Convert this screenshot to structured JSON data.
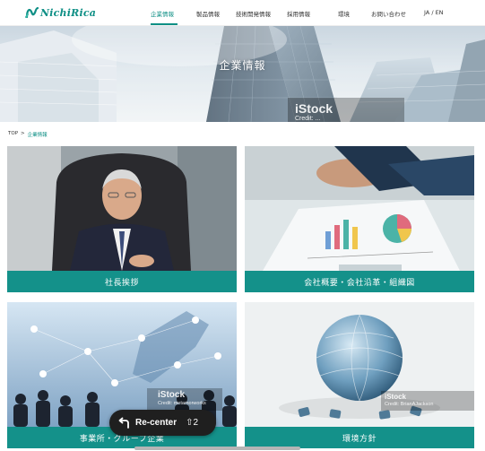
{
  "brand": {
    "name": "NichiRica",
    "color": "#0e8f85"
  },
  "nav": {
    "items": [
      {
        "label": "企業情報",
        "active": true
      },
      {
        "label": "製品情報",
        "active": false
      },
      {
        "label": "技術開発情報",
        "active": false
      },
      {
        "label": "採用情報",
        "active": false
      },
      {
        "label": "環境",
        "active": false
      },
      {
        "label": "お問い合わせ",
        "active": false
      }
    ],
    "lang": "JA / EN"
  },
  "hero": {
    "title": "企業情報",
    "watermark": "iStock",
    "watermark_credit": "Credit: ..."
  },
  "breadcrumb": {
    "home": "TOP",
    "separator": ">",
    "current": "企業情報"
  },
  "cards": [
    {
      "label": "社長挨拶"
    },
    {
      "label": "会社概要・会社沿革・組織図"
    },
    {
      "label": "事業所・グループ企業",
      "watermark": "iStock",
      "credit": "Credit: metamorworks"
    },
    {
      "label": "環境方針",
      "watermark": "iStock",
      "credit": "Credit: BrianAJackson"
    }
  ],
  "overlay": {
    "recenter_label": "Re-center",
    "shortcut": "⇧2"
  },
  "colors": {
    "accent": "#14918a",
    "pill": "#1f1f1f"
  }
}
